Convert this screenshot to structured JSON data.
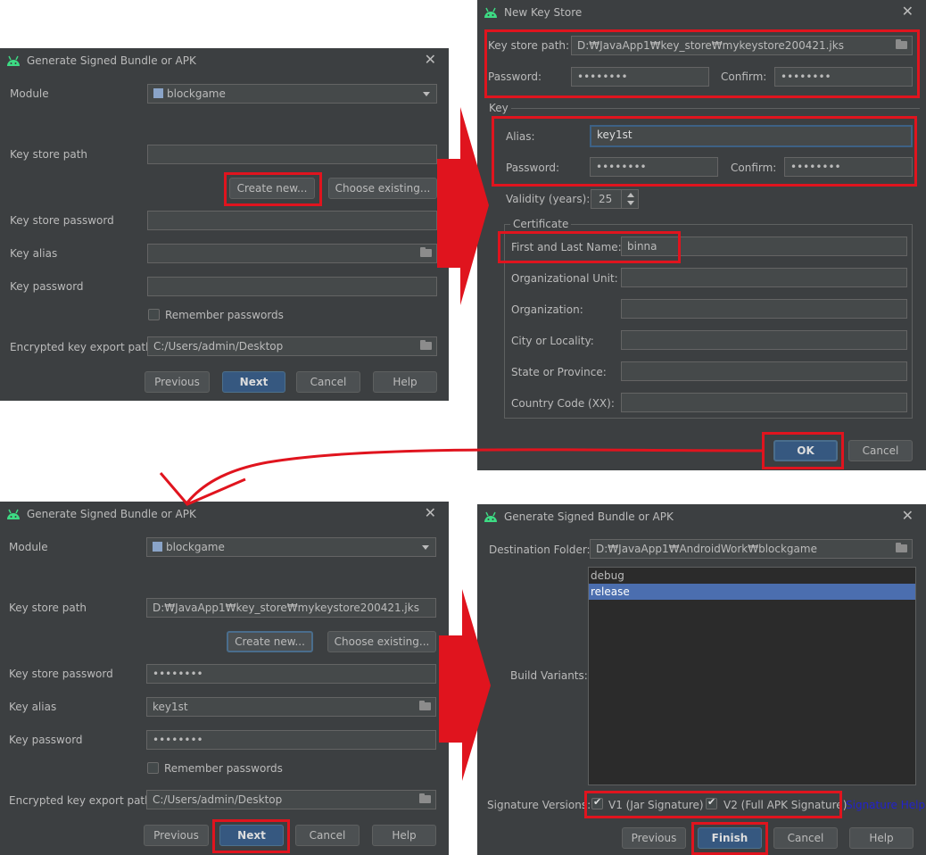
{
  "colors": {
    "dialog_bg": "#3c3f41",
    "field_bg": "#45494a",
    "primary_button": "#365880",
    "selection": "#4b6eaf",
    "highlight": "#e0141e",
    "link": "#2222cc"
  },
  "dialog1": {
    "title": "Generate Signed Bundle or APK",
    "module_label": "Module",
    "module_value": "blockgame",
    "keystore_path_label": "Key store path",
    "keystore_path_value": "",
    "create_new": "Create new...",
    "choose_existing": "Choose existing...",
    "keystore_password_label": "Key store password",
    "keystore_password_value": "",
    "key_alias_label": "Key alias",
    "key_alias_value": "",
    "key_password_label": "Key password",
    "key_password_value": "",
    "remember": "Remember passwords",
    "export_label": "Encrypted key export path",
    "export_value": "C:/Users/admin/Desktop",
    "previous": "Previous",
    "next": "Next",
    "cancel": "Cancel",
    "help": "Help"
  },
  "dialog2": {
    "title": "New Key Store",
    "path_label": "Key store path:",
    "path_value": "D:₩JavaApp1₩key_store₩mykeystore200421.jks",
    "password_label": "Password:",
    "password_value": "••••••••",
    "confirm_label": "Confirm:",
    "confirm_value": "••••••••",
    "key_group": "Key",
    "alias_label": "Alias:",
    "alias_value": "key1st",
    "key_password_label": "Password:",
    "key_password_value": "••••••••",
    "key_confirm_label": "Confirm:",
    "key_confirm_value": "••••••••",
    "validity_label": "Validity (years):",
    "validity_value": "25",
    "cert_group": "Certificate",
    "first_last_label": "First and Last Name:",
    "first_last_value": "binna",
    "org_unit_label": "Organizational Unit:",
    "org_label": "Organization:",
    "city_label": "City or Locality:",
    "state_label": "State or Province:",
    "country_label": "Country Code (XX):",
    "ok": "OK",
    "cancel": "Cancel"
  },
  "dialog3": {
    "title": "Generate Signed Bundle or APK",
    "module_label": "Module",
    "module_value": "blockgame",
    "keystore_path_label": "Key store path",
    "keystore_path_value": "D:₩JavaApp1₩key_store₩mykeystore200421.jks",
    "create_new": "Create new...",
    "choose_existing": "Choose existing...",
    "keystore_password_label": "Key store password",
    "keystore_password_value": "••••••••",
    "key_alias_label": "Key alias",
    "key_alias_value": "key1st",
    "key_password_label": "Key password",
    "key_password_value": "••••••••",
    "remember": "Remember passwords",
    "export_label": "Encrypted key export path",
    "export_value": "C:/Users/admin/Desktop",
    "previous": "Previous",
    "next": "Next",
    "cancel": "Cancel",
    "help": "Help"
  },
  "dialog4": {
    "title": "Generate Signed Bundle or APK",
    "dest_label": "Destination Folder:",
    "dest_value": "D:₩JavaApp1₩AndroidWork₩blockgame",
    "variants_label": "Build Variants:",
    "variants": [
      "debug",
      "release"
    ],
    "signature_label": "Signature Versions:",
    "v1": "V1 (Jar Signature)",
    "v2": "V2 (Full APK Signature)",
    "signature_help": "Signature Help",
    "previous": "Previous",
    "finish": "Finish",
    "cancel": "Cancel",
    "help": "Help"
  }
}
